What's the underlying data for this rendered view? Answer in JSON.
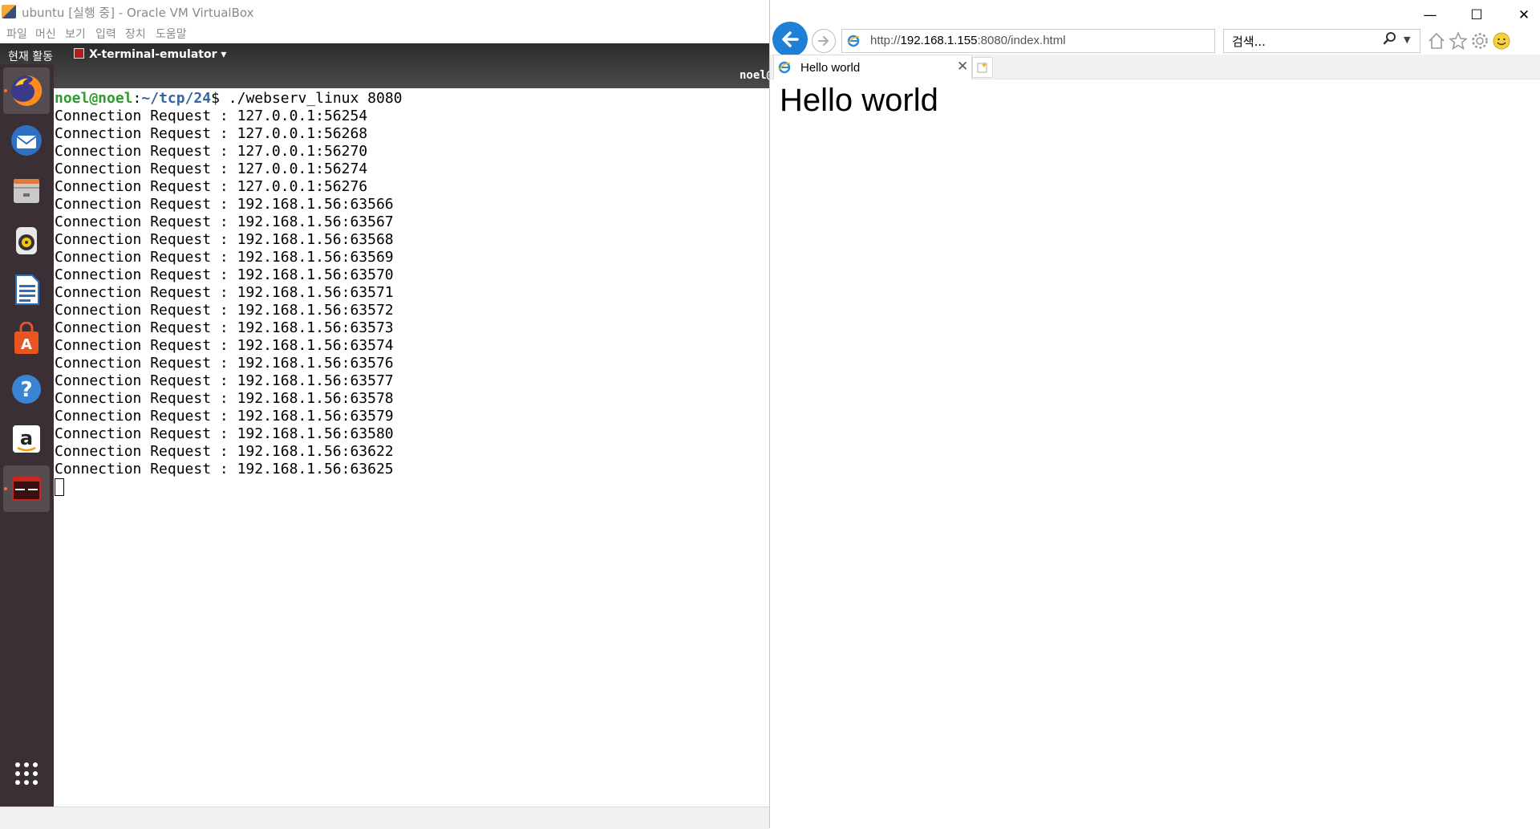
{
  "vbox": {
    "title": "ubuntu [실행 중] - Oracle VM VirtualBox",
    "menu": [
      "파일",
      "머신",
      "보기",
      "입력",
      "장치",
      "도움말"
    ]
  },
  "ubuntu": {
    "activities": "현재 활동",
    "app_menu": "X-terminal-emulator ▾",
    "terminal_header_user": "noel@",
    "dock_items": [
      "firefox",
      "thunderbird",
      "files",
      "rhythmbox",
      "libreoffice-writer",
      "ubuntu-software",
      "help",
      "amazon",
      "terminal",
      "show-applications"
    ]
  },
  "terminal": {
    "prompt_user": "noel@noel",
    "prompt_sep": ":",
    "prompt_path": "~/tcp/24",
    "prompt_symbol": "$",
    "command": " ./webserv_linux 8080",
    "lines": [
      "Connection Request : 127.0.0.1:56254",
      "Connection Request : 127.0.0.1:56268",
      "Connection Request : 127.0.0.1:56270",
      "Connection Request : 127.0.0.1:56274",
      "Connection Request : 127.0.0.1:56276",
      "Connection Request : 192.168.1.56:63566",
      "Connection Request : 192.168.1.56:63567",
      "Connection Request : 192.168.1.56:63568",
      "Connection Request : 192.168.1.56:63569",
      "Connection Request : 192.168.1.56:63570",
      "Connection Request : 192.168.1.56:63571",
      "Connection Request : 192.168.1.56:63572",
      "Connection Request : 192.168.1.56:63573",
      "Connection Request : 192.168.1.56:63574",
      "Connection Request : 192.168.1.56:63576",
      "Connection Request : 192.168.1.56:63577",
      "Connection Request : 192.168.1.56:63578",
      "Connection Request : 192.168.1.56:63579",
      "Connection Request : 192.168.1.56:63580",
      "Connection Request : 192.168.1.56:63622",
      "Connection Request : 192.168.1.56:63625"
    ]
  },
  "ie": {
    "window_buttons": {
      "minimize": "—",
      "maximize": "☐",
      "close": "✕"
    },
    "address_prefix": "http://",
    "address_host": "192.168.1.155",
    "address_rest": ":8080/index.html",
    "search_placeholder": "검색...",
    "tab_title": "Hello world",
    "page_heading": "Hello world"
  },
  "colors": {
    "prompt_user": "#2e9b2e",
    "prompt_path": "#3465a4",
    "dock_bg": "#3a2f34",
    "ie_back": "#1e7fd6"
  }
}
